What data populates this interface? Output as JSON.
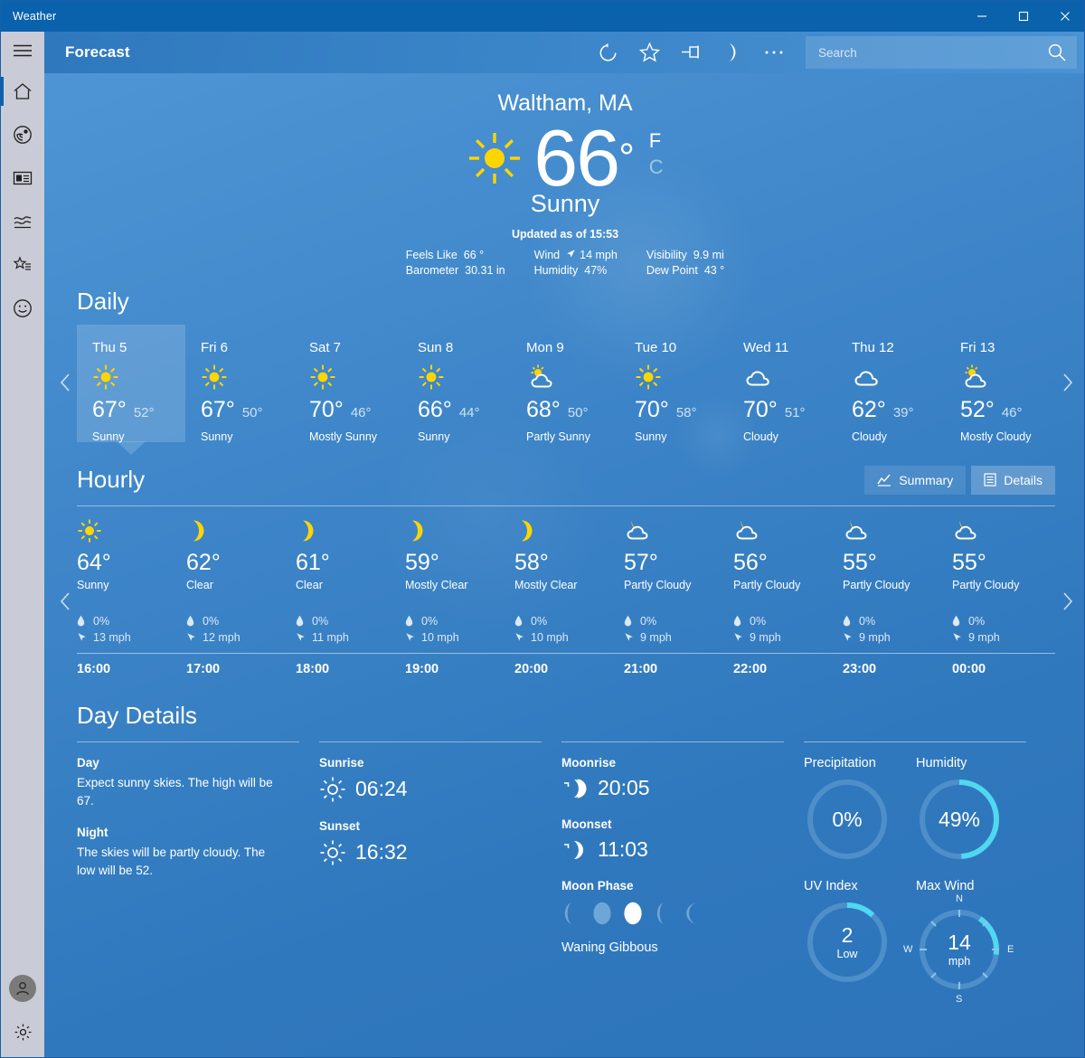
{
  "window": {
    "title": "Weather",
    "controls": {
      "minimize": "minimize-icon",
      "maximize": "maximize-icon",
      "close": "close-icon"
    }
  },
  "header": {
    "title": "Forecast",
    "tools": [
      {
        "name": "refresh-icon",
        "label": "Refresh"
      },
      {
        "name": "favorite-star-icon",
        "label": "Add to Favorites"
      },
      {
        "name": "pin-icon",
        "label": "Pin"
      },
      {
        "name": "night-mode-moon-icon",
        "label": "Night Mode"
      },
      {
        "name": "more-ellipsis-icon",
        "label": "..."
      }
    ],
    "search": {
      "placeholder": "Search",
      "value": "",
      "icon": "search-icon"
    }
  },
  "sidebar": {
    "hamburger": "hamburger-icon",
    "items": [
      {
        "name": "home-icon",
        "label": "Forecast",
        "selected": true
      },
      {
        "name": "radar-maps-icon",
        "label": "Maps",
        "selected": false
      },
      {
        "name": "news-icon",
        "label": "News",
        "selected": false
      },
      {
        "name": "historical-chart-icon",
        "label": "Historical Weather",
        "selected": false
      },
      {
        "name": "favorites-list-icon",
        "label": "Favorites",
        "selected": false
      },
      {
        "name": "feedback-smiley-icon",
        "label": "Send Feedback",
        "selected": false
      }
    ],
    "bottom": [
      {
        "name": "account-avatar-icon",
        "label": "Account"
      },
      {
        "name": "settings-gear-icon",
        "label": "Settings"
      }
    ]
  },
  "current": {
    "city": "Waltham, MA",
    "icon": "sun-icon",
    "temperature": "66",
    "degree": "°",
    "units": {
      "fahrenheit": "F",
      "celsius": "C",
      "active": "F"
    },
    "condition": "Sunny",
    "updated": "Updated as of 15:53",
    "stats": [
      {
        "label": "Feels Like",
        "value": "66 °",
        "icon": null
      },
      {
        "label": "Wind",
        "value": "14 mph",
        "icon": "wind-arrow-icon"
      },
      {
        "label": "Visibility",
        "value": "9.9 mi",
        "icon": null
      },
      {
        "label": "Barometer",
        "value": "30.31 in",
        "icon": null
      },
      {
        "label": "Humidity",
        "value": "47%",
        "icon": null
      },
      {
        "label": "Dew Point",
        "value": "43 °",
        "icon": null
      }
    ]
  },
  "daily": {
    "title": "Daily",
    "prev_arrow": "chevron-left-icon",
    "next_arrow": "chevron-right-icon",
    "days": [
      {
        "name": "Thu 5",
        "icon": "sun-icon",
        "high": "67°",
        "low": "52°",
        "condition": "Sunny",
        "selected": true
      },
      {
        "name": "Fri 6",
        "icon": "sun-icon",
        "high": "67°",
        "low": "50°",
        "condition": "Sunny",
        "selected": false
      },
      {
        "name": "Sat 7",
        "icon": "sun-icon",
        "high": "70°",
        "low": "46°",
        "condition": "Mostly Sunny",
        "selected": false
      },
      {
        "name": "Sun 8",
        "icon": "sun-icon",
        "high": "66°",
        "low": "44°",
        "condition": "Sunny",
        "selected": false
      },
      {
        "name": "Mon 9",
        "icon": "sun-cloud-icon",
        "high": "68°",
        "low": "50°",
        "condition": "Partly Sunny",
        "selected": false
      },
      {
        "name": "Tue 10",
        "icon": "sun-icon",
        "high": "70°",
        "low": "58°",
        "condition": "Sunny",
        "selected": false
      },
      {
        "name": "Wed 11",
        "icon": "cloud-icon",
        "high": "70°",
        "low": "51°",
        "condition": "Cloudy",
        "selected": false
      },
      {
        "name": "Thu 12",
        "icon": "cloud-icon",
        "high": "62°",
        "low": "39°",
        "condition": "Cloudy",
        "selected": false
      },
      {
        "name": "Fri 13",
        "icon": "sun-cloud-icon",
        "high": "52°",
        "low": "46°",
        "condition": "Mostly Cloudy",
        "selected": false
      }
    ]
  },
  "hourly": {
    "title": "Hourly",
    "summary_button": {
      "label": "Summary",
      "icon": "chart-icon",
      "active": false
    },
    "details_button": {
      "label": "Details",
      "icon": "list-details-icon",
      "active": true
    },
    "prev_arrow": "chevron-left-icon",
    "next_arrow": "chevron-right-icon",
    "hours": [
      {
        "time": "16:00",
        "icon": "sun-icon",
        "temp": "64°",
        "condition": "Sunny",
        "precip": "0%",
        "wind": "13 mph"
      },
      {
        "time": "17:00",
        "icon": "moon-icon",
        "temp": "62°",
        "condition": "Clear",
        "precip": "0%",
        "wind": "12 mph"
      },
      {
        "time": "18:00",
        "icon": "moon-icon",
        "temp": "61°",
        "condition": "Clear",
        "precip": "0%",
        "wind": "11 mph"
      },
      {
        "time": "19:00",
        "icon": "moon-icon",
        "temp": "59°",
        "condition": "Mostly Clear",
        "precip": "0%",
        "wind": "10 mph"
      },
      {
        "time": "20:00",
        "icon": "moon-icon",
        "temp": "58°",
        "condition": "Mostly Clear",
        "precip": "0%",
        "wind": "10 mph"
      },
      {
        "time": "21:00",
        "icon": "moon-cloud-icon",
        "temp": "57°",
        "condition": "Partly Cloudy",
        "precip": "0%",
        "wind": "9 mph"
      },
      {
        "time": "22:00",
        "icon": "moon-cloud-icon",
        "temp": "56°",
        "condition": "Partly Cloudy",
        "precip": "0%",
        "wind": "9 mph"
      },
      {
        "time": "23:00",
        "icon": "moon-cloud-icon",
        "temp": "55°",
        "condition": "Partly Cloudy",
        "precip": "0%",
        "wind": "9 mph"
      },
      {
        "time": "00:00",
        "icon": "moon-cloud-icon",
        "temp": "55°",
        "condition": "Partly Cloudy",
        "precip": "0%",
        "wind": "9 mph"
      }
    ],
    "precip_icon": "water-drop-icon",
    "wind_icon": "wind-arrow-icon"
  },
  "day_details": {
    "title": "Day Details",
    "day": {
      "heading": "Day",
      "text": "Expect sunny skies. The high will be 67."
    },
    "night": {
      "heading": "Night",
      "text": "The skies will be partly cloudy. The low will be 52."
    },
    "sunrise": {
      "heading": "Sunrise",
      "value": "06:24",
      "icon": "sunrise-sun-icon"
    },
    "sunset": {
      "heading": "Sunset",
      "value": "16:32",
      "icon": "sunset-sun-icon"
    },
    "moonrise": {
      "heading": "Moonrise",
      "value": "20:05",
      "icon": "moonrise-icon"
    },
    "moonset": {
      "heading": "Moonset",
      "value": "11:03",
      "icon": "moonset-icon"
    },
    "moon_phase": {
      "heading": "Moon Phase",
      "caption": "Waning Gibbous",
      "phases": [
        {
          "name": "moon-phase-1-icon",
          "active": false
        },
        {
          "name": "moon-phase-2-icon",
          "active": false
        },
        {
          "name": "moon-phase-full-icon",
          "active": true
        },
        {
          "name": "moon-phase-4-icon",
          "active": false
        },
        {
          "name": "moon-phase-5-icon",
          "active": false
        }
      ]
    },
    "gauges": [
      {
        "title": "Precipitation",
        "value": "0%",
        "sub": "",
        "percent": 0,
        "type": "ring"
      },
      {
        "title": "Humidity",
        "value": "49%",
        "sub": "",
        "percent": 49,
        "type": "ring"
      },
      {
        "title": "UV Index",
        "value": "2",
        "sub": "Low",
        "percent": 12,
        "type": "ring"
      },
      {
        "title": "Max Wind",
        "value": "14",
        "sub": "mph",
        "percent": 14,
        "type": "compass",
        "compass": {
          "n": "N",
          "e": "E",
          "s": "S",
          "w": "W"
        }
      }
    ]
  },
  "colors": {
    "titlebar": "#0a62ad",
    "accent_cyan": "#4fd8ef",
    "sun_yellow": "#ffd500",
    "rail_bg": "#c9ccd6"
  }
}
